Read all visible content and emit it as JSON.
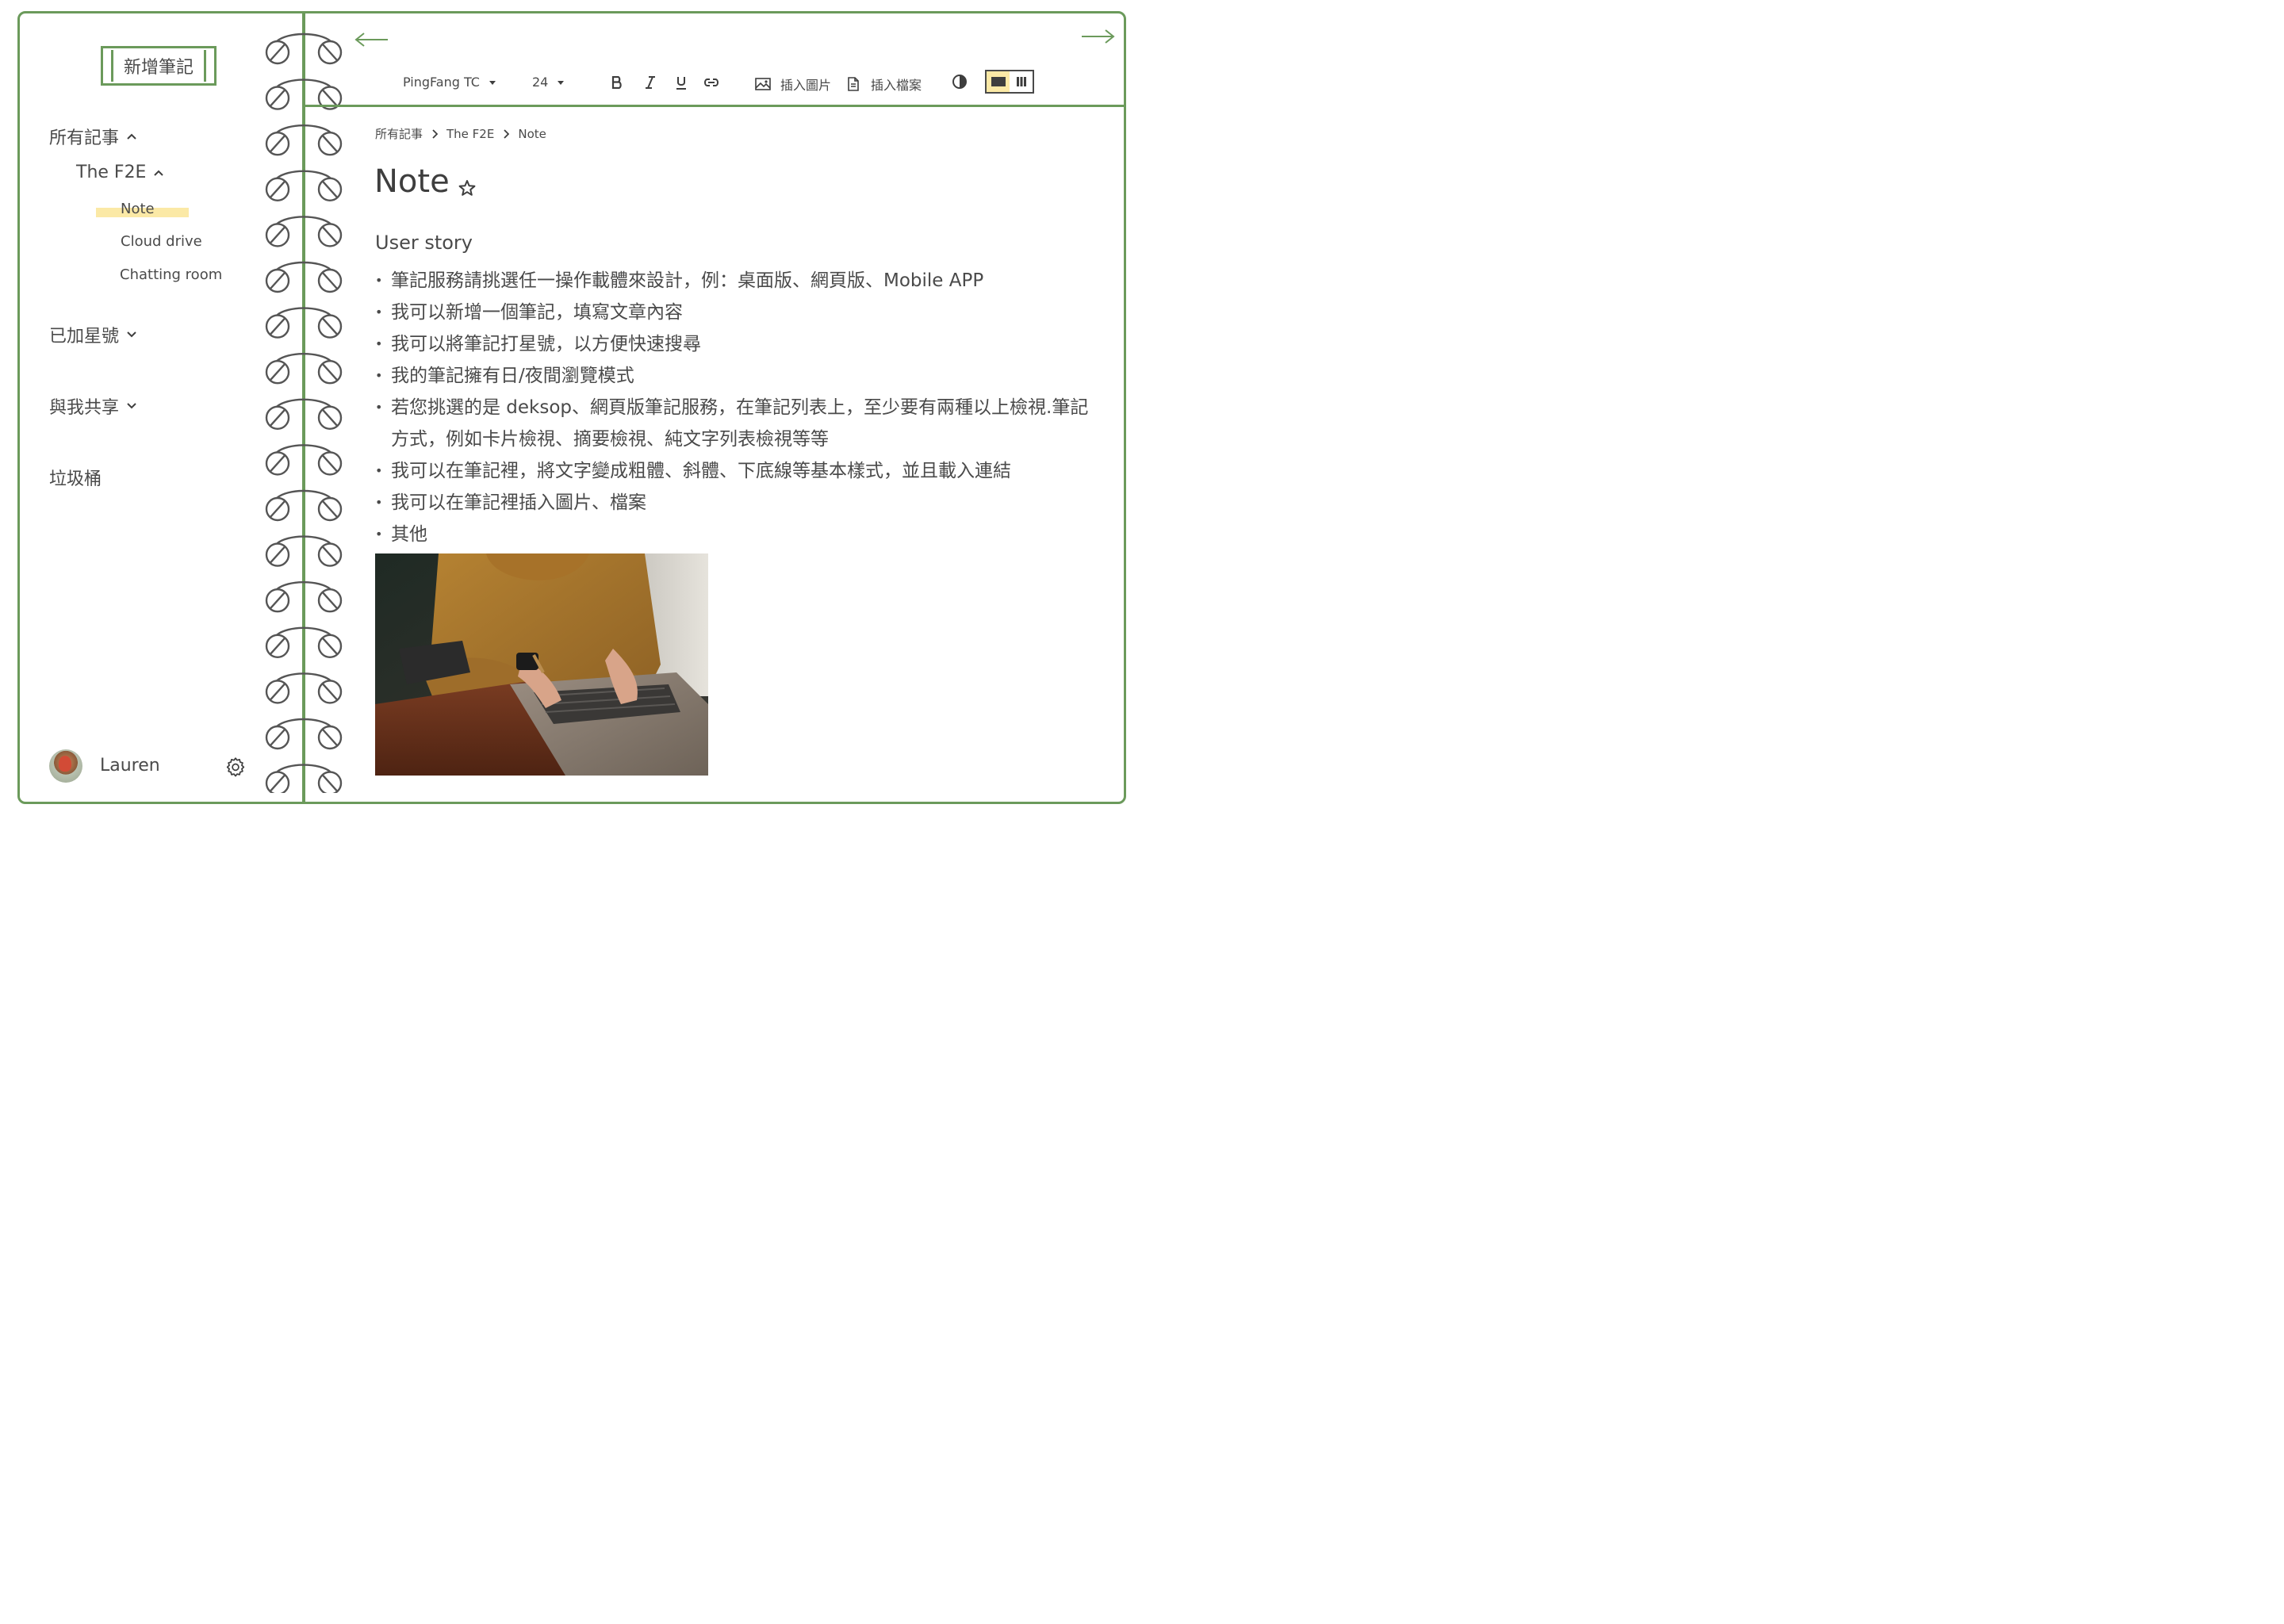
{
  "sidebar": {
    "new_note_label": "新增筆記",
    "all_notes_label": "所有記事",
    "folder_label": "The F2E",
    "notes": [
      {
        "label": "Note",
        "active": true
      },
      {
        "label": "Cloud drive",
        "active": false
      },
      {
        "label": "Chatting room",
        "active": false
      }
    ],
    "starred_label": "已加星號",
    "shared_label": "與我共享",
    "trash_label": "垃圾桶",
    "user_name": "Lauren"
  },
  "toolbar": {
    "font_family": "PingFang TC",
    "font_size": "24",
    "insert_image_label": "插入圖片",
    "insert_file_label": "插入檔案"
  },
  "breadcrumb": {
    "items": [
      "所有記事",
      "The F2E",
      "Note"
    ]
  },
  "note": {
    "title": "Note",
    "heading": "User story",
    "items": [
      "筆記服務請挑選任一操作載體來設計，例：桌面版、網頁版、Mobile APP",
      "我可以新增一個筆記，填寫文章內容",
      "我可以將筆記打星號，以方便快速搜尋",
      "我的筆記擁有日/夜間瀏覽模式",
      "若您挑選的是 deksop、網頁版筆記服務，在筆記列表上，至少要有兩種以上檢視.筆記方式，例如卡片檢視、摘要檢視、純文字列表檢視等等",
      "我可以在筆記裡，將文字變成粗體、斜體、下底線等基本樣式，並且載入連結",
      "我可以在筆記裡插入圖片、檔案",
      "其他"
    ]
  },
  "colors": {
    "accent": "#6b9a5b",
    "highlight": "#fbe9a6",
    "text": "#4a4a4a"
  },
  "icons": {
    "back": "arrow-left-icon",
    "forward": "arrow-right-icon",
    "settings": "gear-icon",
    "star": "star-icon"
  }
}
